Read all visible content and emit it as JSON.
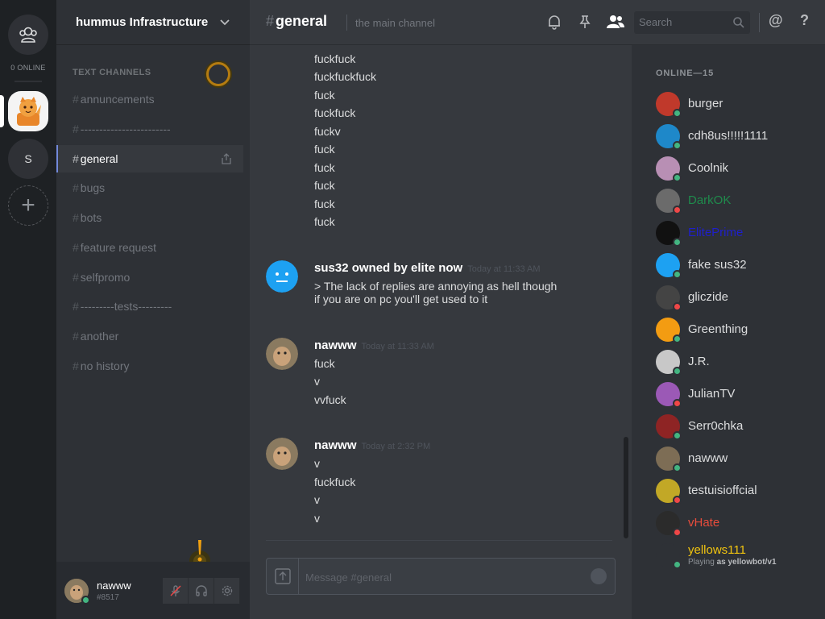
{
  "guilds": {
    "online": "0 ONLINE",
    "s_label": "S",
    "add_label": "+"
  },
  "server": {
    "name": "hummus Infrastructure",
    "category": "TEXT CHANNELS",
    "channels": [
      {
        "name": "annuncements"
      },
      {
        "name": "------------------------"
      },
      {
        "name": "general"
      },
      {
        "name": "bugs"
      },
      {
        "name": "bots"
      },
      {
        "name": "feature request"
      },
      {
        "name": "selfpromo"
      },
      {
        "name": "---------tests---------"
      },
      {
        "name": "another"
      },
      {
        "name": "no history"
      }
    ]
  },
  "user": {
    "name": "nawww",
    "tag": "#8517"
  },
  "header": {
    "channel": "general",
    "topic": "the main channel",
    "search_placeholder": "Search",
    "mention": "@",
    "help": "?"
  },
  "messages": {
    "top_lines": [
      "fuckfuck",
      "fuckfuckfuck",
      "fuck",
      "fuckfuck",
      "fuckv",
      "fuck",
      "fuck",
      "fuck",
      "fuck",
      "fuck"
    ],
    "groups": [
      {
        "author": "sus32 owned by elite now",
        "time": "Today at 11:33 AM",
        "lines": [
          "> The lack of replies are annoying as hell though",
          "if you are on pc you'll get used to it"
        ]
      },
      {
        "author": "nawww",
        "time": "Today at 11:33 AM",
        "lines": [
          "fuck",
          "v",
          "vvfuck"
        ]
      },
      {
        "author": "nawww",
        "time": "Today at 2:32 PM",
        "lines": [
          "v",
          "fuckfuck",
          "v",
          "v"
        ]
      }
    ],
    "input_placeholder": "Message #general"
  },
  "members": {
    "title": "ONLINE—15",
    "list": [
      {
        "name": "burger",
        "color": "#dcddde",
        "status": "online",
        "avatar": "#c0392b"
      },
      {
        "name": "cdh8us!!!!!1111",
        "color": "#dcddde",
        "status": "online",
        "avatar": "#1e88c9"
      },
      {
        "name": "Coolnik",
        "color": "#dcddde",
        "status": "online",
        "avatar": "#b88fb4"
      },
      {
        "name": "DarkOK",
        "color": "#1f8b4c",
        "status": "dnd",
        "avatar": "#6b6b6b"
      },
      {
        "name": "ElitePrime",
        "color": "#1f1fcc",
        "status": "online",
        "avatar": "#111111"
      },
      {
        "name": "fake sus32",
        "color": "#dcddde",
        "status": "online",
        "avatar": "#1da1f2"
      },
      {
        "name": "gliczide",
        "color": "#dcddde",
        "status": "dnd",
        "avatar": "#444444"
      },
      {
        "name": "Greenthing",
        "color": "#dcddde",
        "status": "online",
        "avatar": "#f39c12"
      },
      {
        "name": "J.R.",
        "color": "#dcddde",
        "status": "online",
        "avatar": "#c8c8c8"
      },
      {
        "name": "JulianTV",
        "color": "#dcddde",
        "status": "dnd",
        "avatar": "#9b59b6"
      },
      {
        "name": "Serr0chka",
        "color": "#dcddde",
        "status": "online",
        "avatar": "#8e2424"
      },
      {
        "name": "nawww",
        "color": "#dcddde",
        "status": "online",
        "avatar": "#7d6d55"
      },
      {
        "name": "testuisioffcial",
        "color": "#dcddde",
        "status": "dnd",
        "avatar": "#c2a826"
      },
      {
        "name": "vHate",
        "color": "#e74c3c",
        "status": "dnd",
        "avatar": "#2b2b2b"
      },
      {
        "name": "yellows111",
        "color": "#f1c40f",
        "status": "online",
        "avatar": "#2e3136",
        "activity_prefix": "Playing",
        "activity_game": "as yellowbot/v1"
      }
    ]
  },
  "colors": {
    "online": "#43b581",
    "dnd": "#f04747",
    "accent": "#7289da"
  }
}
